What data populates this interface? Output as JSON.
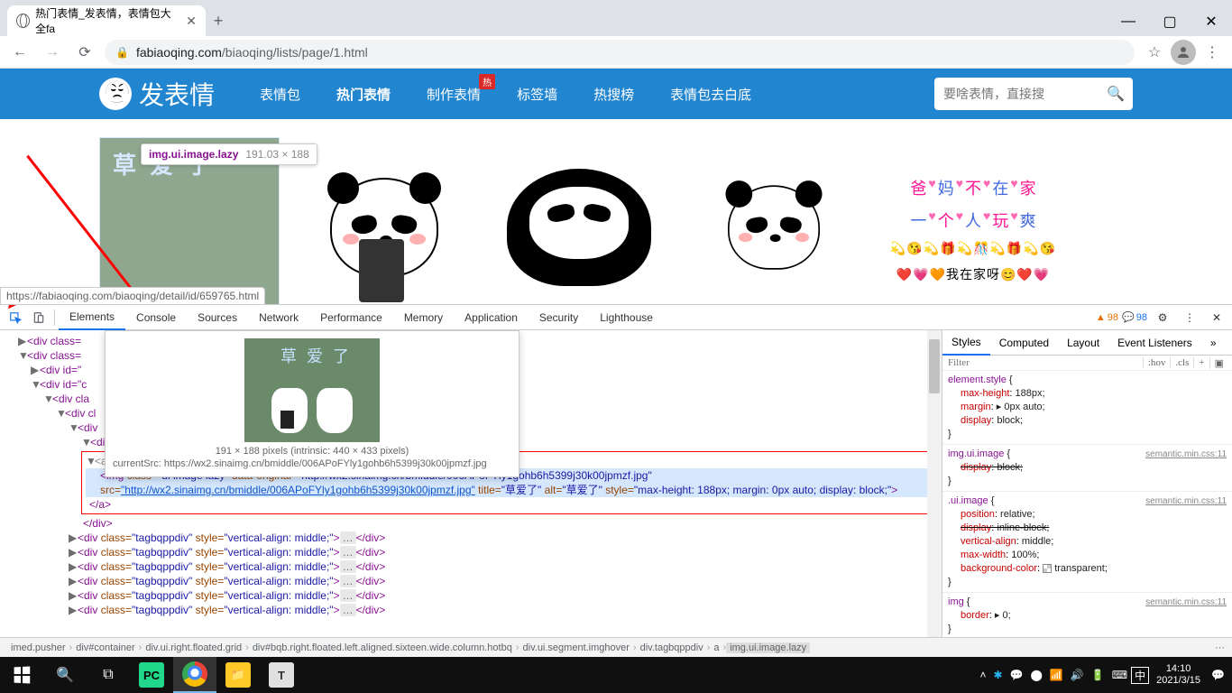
{
  "browser": {
    "tab_title": "热门表情_发表情，表情包大全fa",
    "url_domain": "fabiaoqing.com",
    "url_path": "/biaoqing/lists/page/1.html",
    "status_url": "https://fabiaoqing.com/biaoqing/detail/id/659765.html"
  },
  "win_controls": {
    "min": "—",
    "max": "▢",
    "close": "✕"
  },
  "site": {
    "logo": "发表情",
    "nav": [
      "表情包",
      "热门表情",
      "制作表情",
      "标签墙",
      "热搜榜",
      "表情包去白底"
    ],
    "nav_active_index": 1,
    "badge": "热",
    "search_placeholder": "要啥表情，直接搜",
    "img1_text": "草 爱 了",
    "img5_line1": [
      "爸",
      "妈",
      "不",
      "在",
      "家"
    ],
    "img5_line2": [
      "一",
      "个",
      "人",
      "玩",
      "爽"
    ],
    "img5_line3": "💫😘💫🎁💫🎊💫🎁💫😘",
    "img5_line4": "❤️💗🧡我在家呀😊❤️💗"
  },
  "tooltip": {
    "selector": "img.ui.image.lazy",
    "dims": "191.03 × 188"
  },
  "devtools": {
    "tabs": [
      "Elements",
      "Console",
      "Sources",
      "Network",
      "Performance",
      "Memory",
      "Application",
      "Security",
      "Lighthouse"
    ],
    "active_tab": 0,
    "warn_count": "98",
    "info_count": "98",
    "hover_dims": "191 × 188 pixels (intrinsic: 440 × 433 pixels)",
    "hover_src": "currentSrc: https://wx2.sinaimg.cn/bmiddle/006APoFYly1gohb6h5399j30k00jpmzf.jpg",
    "hover_img_text": "草 爱 了",
    "dom": {
      "l1": "<div class=",
      "l2": "<div class=",
      "l3": "<div id=\"",
      "l4": "<div id=\"c",
      "l5": "<div cla",
      "l6": "<div cl",
      "l7": "<div",
      "l8": "<di",
      "img_tag": "<img",
      "img_class_attr": " class=",
      "img_class": "\"ui image lazy\"",
      "img_dataorig_attr": " data-original=",
      "img_dataorig": "\"http://wx2.sinaimg.cn/bmiddle/006APoFYly1gohb6h5399j30k00jpmzf.jpg\"",
      "img_src_attr": " src=",
      "img_src": "\"http://wx2.sinaimg.cn/bmiddle/006APoFYly1gohb6h5399j30k00jpmzf.jpg\"",
      "img_title_attr": " title=",
      "img_title": "\"草爱了\"",
      "img_alt_attr": " alt=",
      "img_alt": "\"草爱了\"",
      "img_style_attr": " style=",
      "img_style": "\"max-height: 188px; margin: 0px auto; display: block;\"",
      "close_a": "</a>",
      "close_div": "</div>",
      "tag_line_pre": "<div",
      "tag_class_attr": " class=",
      "tag_class": "\"tagbqppdiv\"",
      "tag_style_attr": " style=",
      "tag_style": "\"vertical-align: middle;\"",
      "tag_close": "</div>"
    },
    "styles_tabs": [
      "Styles",
      "Computed",
      "Layout",
      "Event Listeners"
    ],
    "filter_placeholder": "Filter",
    "hov": ":hov",
    "cls": ".cls",
    "rules": [
      {
        "sel": "element.style",
        "src": "",
        "props": [
          {
            "p": "max-height",
            "v": "188px"
          },
          {
            "p": "margin",
            "v": "▸ 0px auto"
          },
          {
            "p": "display",
            "v": "block"
          }
        ]
      },
      {
        "sel": "img.ui.image",
        "src": "semantic.min.css:11",
        "props": [
          {
            "p": "display",
            "v": "block",
            "strike": true
          }
        ]
      },
      {
        "sel": ".ui.image",
        "src": "semantic.min.css:11",
        "props": [
          {
            "p": "position",
            "v": "relative"
          },
          {
            "p": "display",
            "v": "inline-block",
            "strike": true
          },
          {
            "p": "vertical-align",
            "v": "middle"
          },
          {
            "p": "max-width",
            "v": "100%"
          },
          {
            "p": "background-color",
            "v": "transparent",
            "color": true
          }
        ]
      },
      {
        "sel": "img",
        "src": "semantic.min.css:11",
        "props": [
          {
            "p": "border",
            "v": "▸ 0"
          }
        ]
      }
    ],
    "breadcrumb": [
      "imed.pusher",
      "div#container",
      "div.ui.right.floated.grid",
      "div#bqb.right.floated.left.aligned.sixteen.wide.column.hotbq",
      "div.ui.segment.imghover",
      "div.tagbqppdiv",
      "a",
      "img.ui.image.lazy"
    ]
  },
  "taskbar": {
    "time": "14:10",
    "date": "2021/3/15",
    "ime": "中"
  }
}
